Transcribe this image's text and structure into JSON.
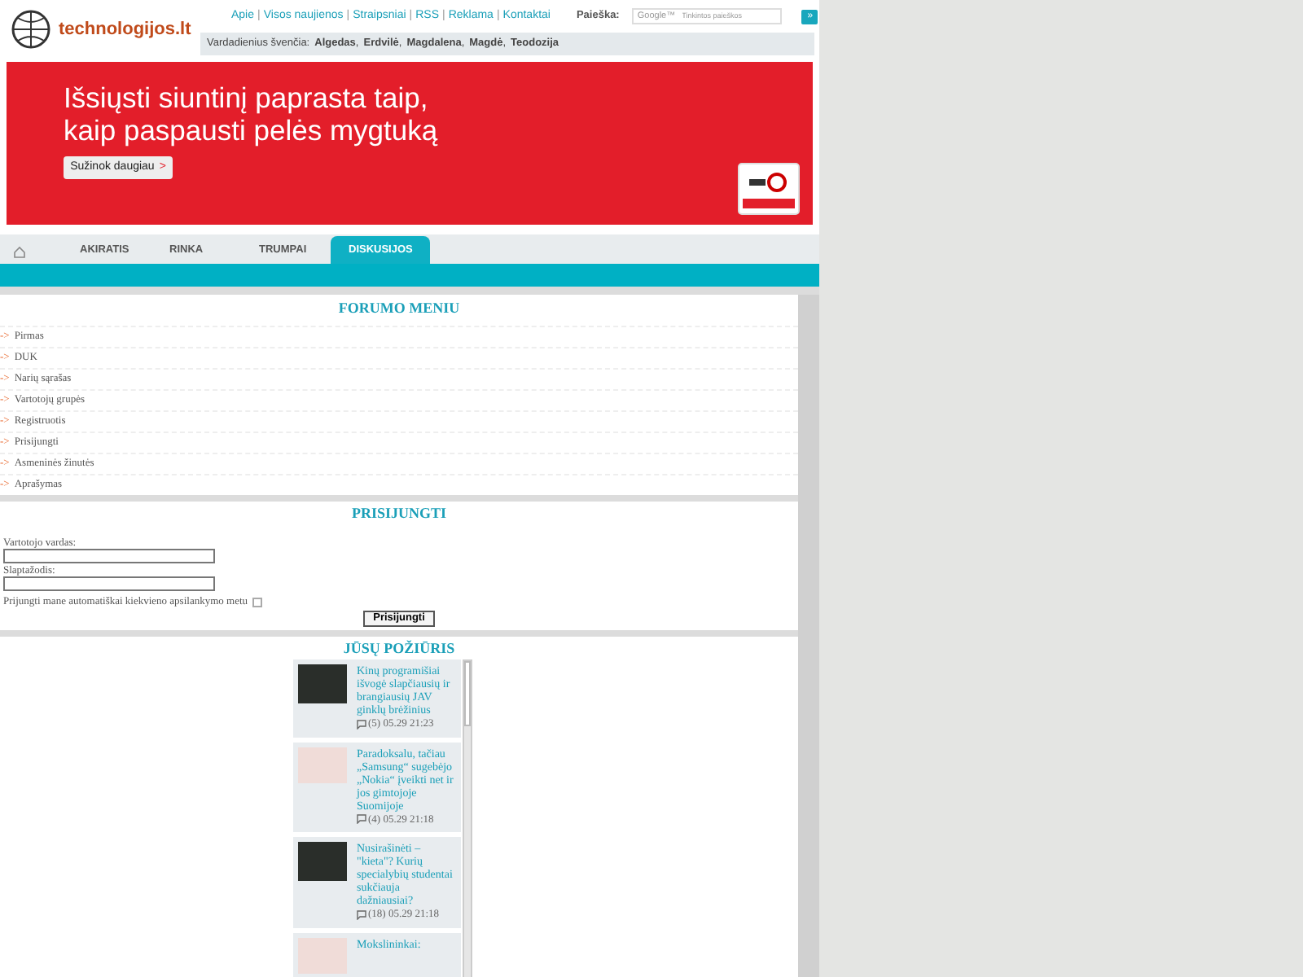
{
  "header": {
    "logo_text": "technologijos.lt",
    "top_links": [
      {
        "label": "Apie"
      },
      {
        "sep": "|",
        "label": "Visos naujienos"
      },
      {
        "sep": "|",
        "label": "Straipsniai"
      },
      {
        "sep": "|",
        "label": "RSS"
      },
      {
        "sep": "|",
        "label": "Reklama"
      },
      {
        "sep": "|",
        "label": "Kontaktai"
      }
    ],
    "search": {
      "label": "Paieška:",
      "brand": "Google™",
      "placeholder": "Tinkintos paieškos",
      "button": "»"
    },
    "namedays": {
      "label": "Vardadienius švenčia:",
      "names": [
        {
          "name": "Algedas",
          "comma": ","
        },
        {
          "name": "Erdvilė",
          "comma": ","
        },
        {
          "name": "Magdalena",
          "comma": ","
        },
        {
          "name": "Magdė",
          "comma": ","
        },
        {
          "name": "Teodozija"
        }
      ]
    }
  },
  "banner": {
    "headline": [
      "Išsiųsti siuntinį paprasta taip,",
      "kaip paspausti pelės mygtuką"
    ],
    "button": "Sužinok daugiau",
    "button_arrow": ">"
  },
  "tabs": [
    {
      "label": "AKIRATIS",
      "selected": false
    },
    {
      "label": "RINKA",
      "selected": false
    },
    {
      "label": "TRUMPAI",
      "selected": false
    },
    {
      "label": "DISKUSIJOS",
      "selected": true
    }
  ],
  "forum_menu": {
    "title": "FORUMO MENIU",
    "items": [
      {
        "arrow": "->",
        "label": "Pirmas"
      },
      {
        "arrow": "->",
        "label": "DUK"
      },
      {
        "arrow": "->",
        "label": "Narių sąrašas"
      },
      {
        "arrow": "->",
        "label": "Vartotojų grupės"
      },
      {
        "arrow": "->",
        "label": "Registruotis"
      },
      {
        "arrow": "->",
        "label": "Prisijungti"
      },
      {
        "arrow": "->",
        "label": "Asmeninės žinutės"
      },
      {
        "arrow": "->",
        "label": "Aprašymas"
      }
    ]
  },
  "login": {
    "title": "PRISIJUNGTI",
    "username_label": "Vartotojo vardas:",
    "password_label": "Slaptažodis:",
    "remember_label": "Prijungti mane automatiškai kiekvieno apsilankymo metu",
    "remember_checked": false,
    "button": "Prisijungti"
  },
  "opinions": {
    "title": "JŪSŲ POŽIŪRIS",
    "articles": [
      {
        "title": "Kinų programišiai išvogė slapčiausių ir brangiausių JAV ginklų brėžinius",
        "meta": "(5) 05.29 21:23"
      },
      {
        "title": "Paradoksalu, tačiau „Samsung“ sugebėjo „Nokia“ įveikti net ir jos gimtojoje Suomijoje",
        "meta": "(4) 05.29 21:18"
      },
      {
        "title": "Nusirašinėti – \"kieta\"? Kurių specialybių studentai sukčiauja dažniausiai?",
        "meta": "(18) 05.29 21:18"
      },
      {
        "title": "Mokslininkai:"
      }
    ]
  }
}
